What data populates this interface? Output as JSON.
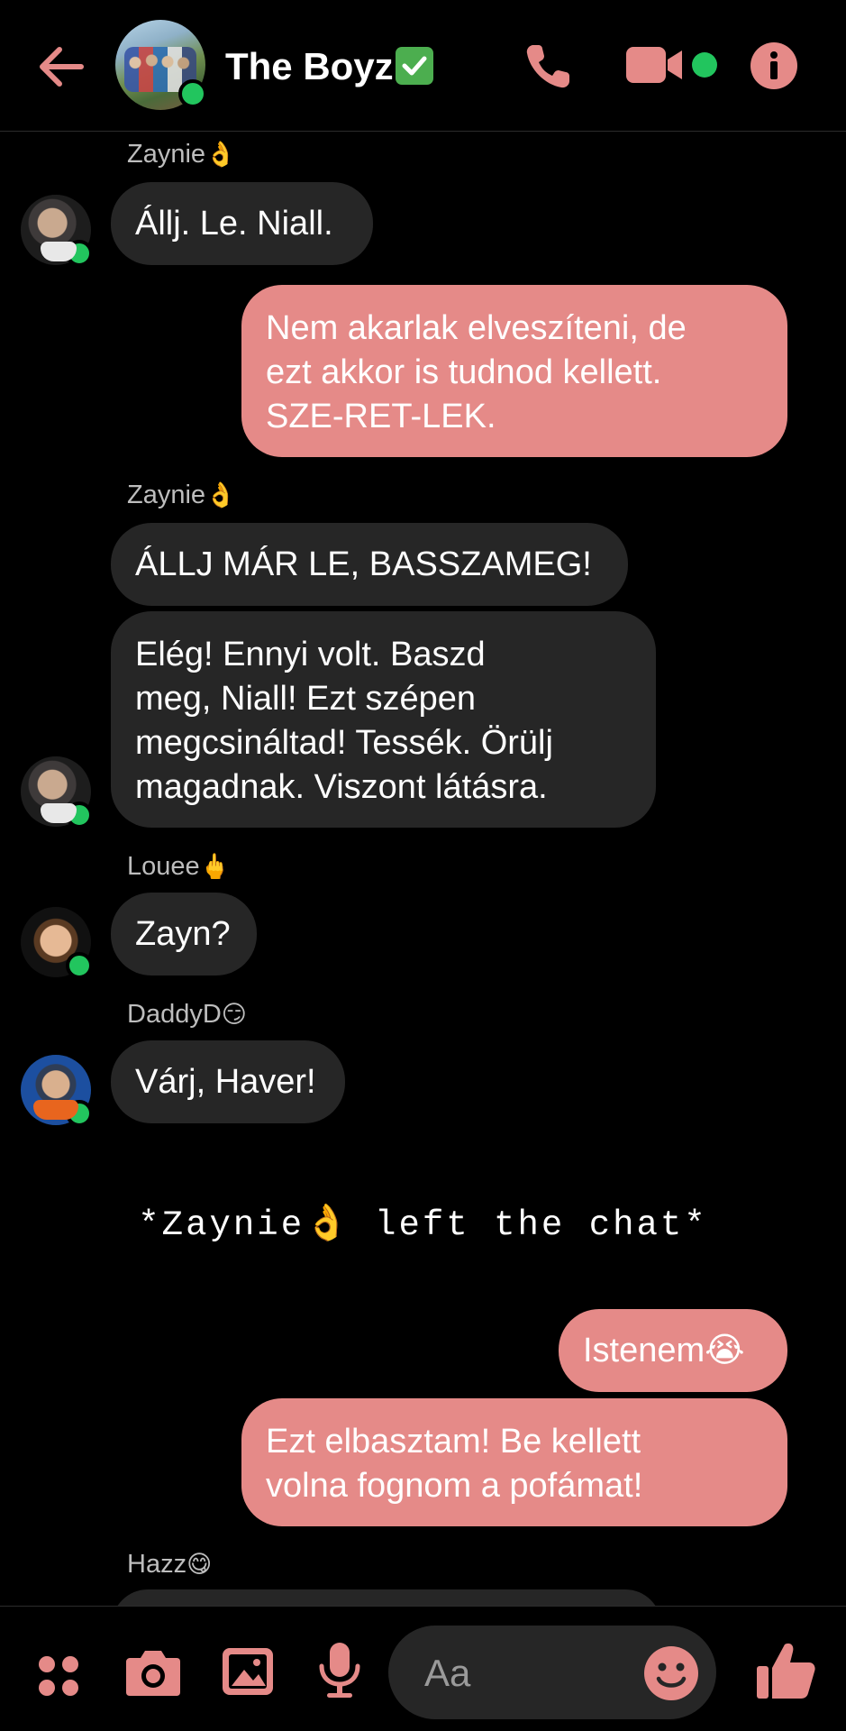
{
  "header": {
    "title": "The Boyz",
    "title_badge": "✅",
    "icons": [
      "back-arrow-icon",
      "phone-icon",
      "video-camera-icon",
      "info-icon"
    ],
    "accent_color": "#e58a88",
    "online_color": "#22c55e"
  },
  "messages": [
    {
      "sender": "Zaynie",
      "sender_emoji": "👌",
      "text": "Állj. Le. Niall."
    },
    {
      "sender": "me",
      "lines": [
        "Nem akarlak elveszíteni, de",
        "ezt akkor is tudnod kellett.",
        "SZE-RET-LEK."
      ]
    },
    {
      "sender": "Zaynie",
      "sender_emoji": "👌",
      "text": "ÁLLJ MÁR LE, BASSZAMEG!"
    },
    {
      "sender": "Zaynie",
      "lines": [
        "Elég! Ennyi volt. Baszd",
        "meg, Niall! Ezt szépen",
        "megcsináltad! Tessék. Örülj",
        "magadnak. Viszont látásra."
      ]
    },
    {
      "sender": "Louee",
      "sender_emoji": "🖕",
      "text": "Zayn?"
    },
    {
      "sender": "DaddyD",
      "sender_emoji": "😏",
      "text": "Várj, Haver!"
    },
    {
      "sender": "me",
      "text": "Istenem😭"
    },
    {
      "sender": "me",
      "lines": [
        "Ezt elbasztam! Be kellett",
        "volna fognom a pofámat!"
      ]
    },
    {
      "sender": "Hazz",
      "sender_emoji": "😋"
    }
  ],
  "system_message": "*Zaynie👌 left the chat*",
  "composer": {
    "placeholder": "Aa",
    "icons": [
      "apps-icon",
      "camera-icon",
      "gallery-icon",
      "microphone-icon",
      "emoji-icon",
      "thumbs-up-icon"
    ]
  }
}
